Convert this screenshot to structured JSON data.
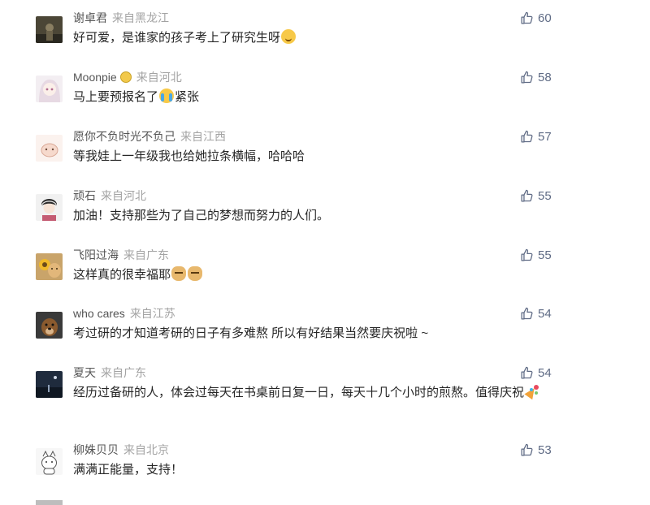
{
  "comments": [
    {
      "username": "谢卓君",
      "source": "来自黑龙江",
      "text": "好可爱，是谁家的孩子考上了研究生呀",
      "emojis": [
        "smile"
      ],
      "likes": "60",
      "avatar_icon": "dark-photo-avatar",
      "badge": false
    },
    {
      "username": "Moonpie",
      "source": "来自河北",
      "text": "马上要预报名了",
      "text_after": "紧张",
      "emojis": [
        "cry"
      ],
      "likes": "58",
      "avatar_icon": "anime-girl-avatar",
      "badge": true
    },
    {
      "username": "愿你不负时光不负己",
      "source": "来自江西",
      "text": "等我娃上一年级我也给她拉条横幅，哈哈哈",
      "emojis": [],
      "likes": "57",
      "avatar_icon": "cartoon-cat-avatar",
      "badge": false
    },
    {
      "username": "顽石",
      "source": "来自河北",
      "text": "加油！支持那些为了自己的梦想而努力的人们。",
      "emojis": [],
      "likes": "55",
      "avatar_icon": "boy-avatar",
      "badge": false
    },
    {
      "username": "飞阳过海",
      "source": "来自广东",
      "text": "这样真的很幸福耶",
      "emojis": [
        "doge",
        "doge"
      ],
      "likes": "55",
      "avatar_icon": "sunflower-avatar",
      "badge": false
    },
    {
      "username": "who cares",
      "source": "来自江苏",
      "text": "考过研的才知道考研的日子有多难熬 所以有好结果当然要庆祝啦 ~",
      "emojis": [],
      "likes": "54",
      "avatar_icon": "dog-avatar",
      "badge": false
    },
    {
      "username": "夏天",
      "source": "来自广东",
      "text": "经历过备研的人，体会过每天在书桌前日复一日，每天十几个小时的煎熬。值得庆祝",
      "emojis": [
        "party"
      ],
      "likes": "54",
      "avatar_icon": "night-scene-avatar",
      "badge": false
    },
    {
      "username": "柳姝贝贝",
      "source": "来自北京",
      "text": "满满正能量，支持！",
      "emojis": [],
      "likes": "53",
      "avatar_icon": "white-cat-avatar",
      "badge": false
    }
  ],
  "colors": {
    "username": "#555555",
    "source": "#a3a3a3",
    "text": "#262626",
    "like": "#5f6b85"
  },
  "like_icon": "thumbs-up-icon"
}
